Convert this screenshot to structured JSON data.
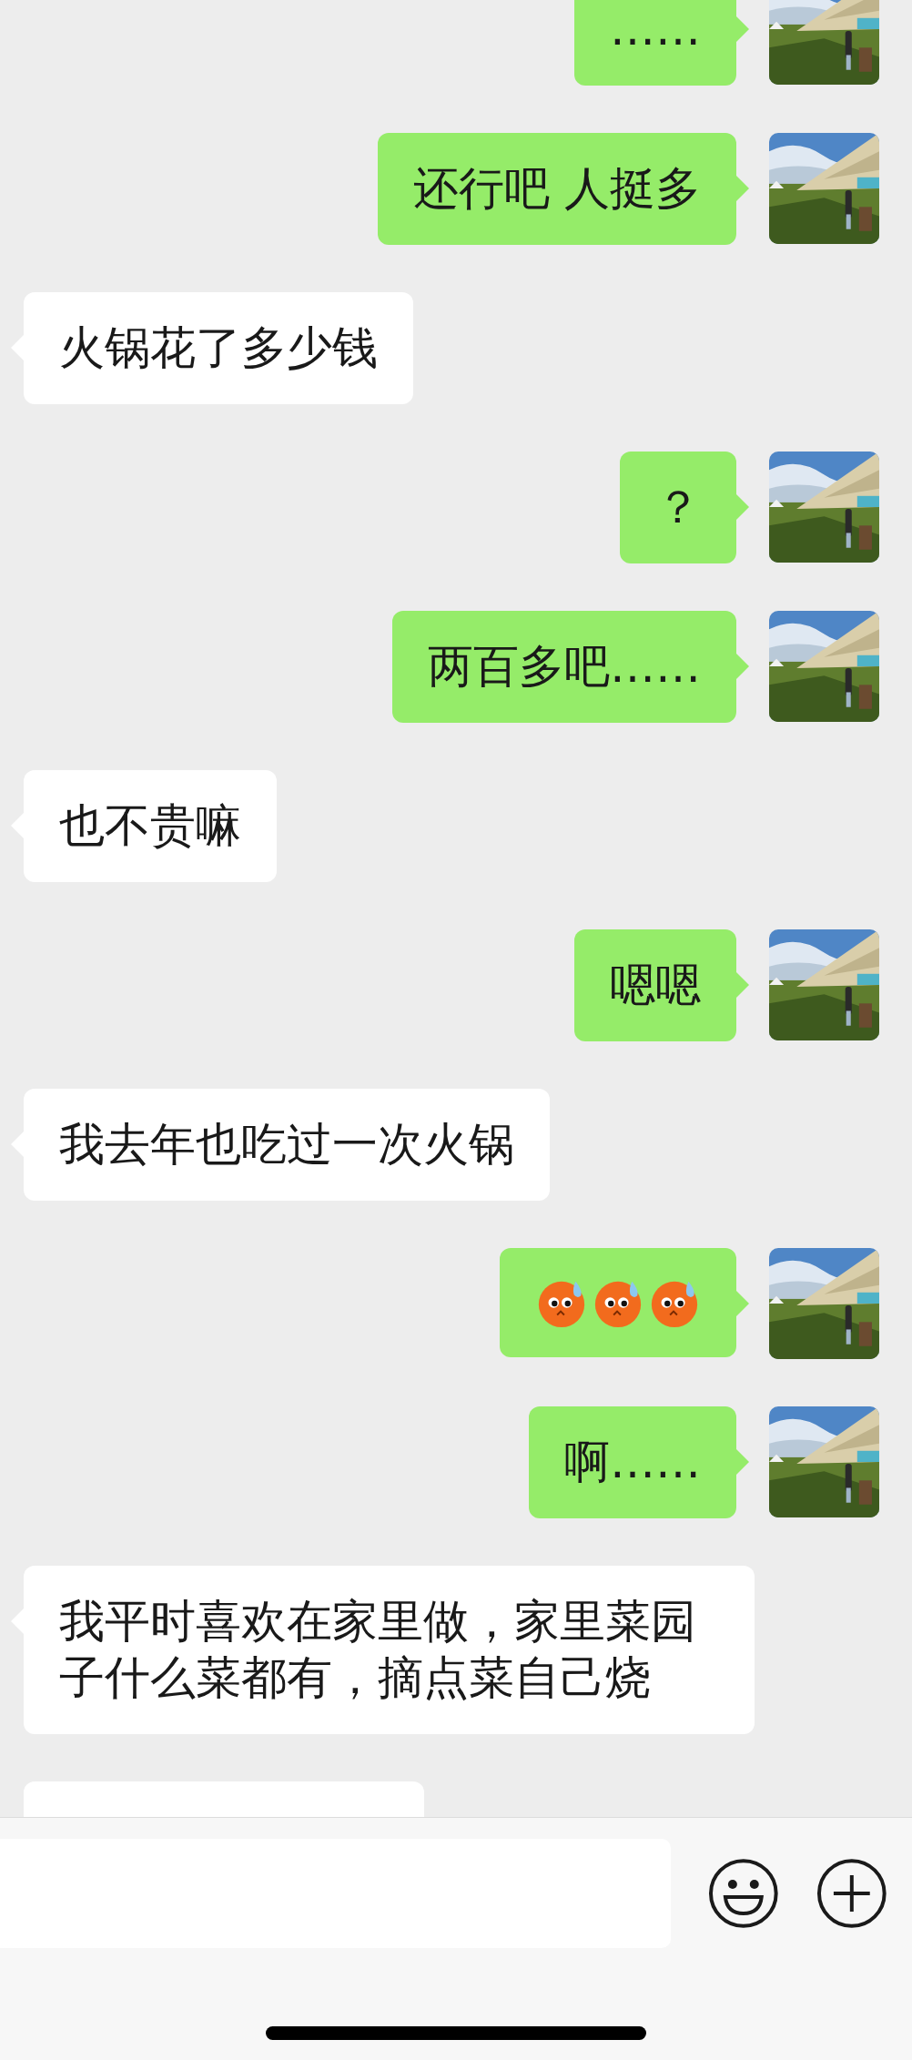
{
  "messages": [
    {
      "outgoing": true,
      "kind": "text",
      "text": "……"
    },
    {
      "outgoing": true,
      "kind": "text",
      "text": "还行吧  人挺多"
    },
    {
      "outgoing": false,
      "kind": "text",
      "text": "火锅花了多少钱"
    },
    {
      "outgoing": true,
      "kind": "text",
      "text": "？"
    },
    {
      "outgoing": true,
      "kind": "text",
      "text": "两百多吧……"
    },
    {
      "outgoing": false,
      "kind": "text",
      "text": "也不贵嘛"
    },
    {
      "outgoing": true,
      "kind": "text",
      "text": "嗯嗯"
    },
    {
      "outgoing": false,
      "kind": "text",
      "text": "我去年也吃过一次火锅"
    },
    {
      "outgoing": true,
      "kind": "emoji",
      "emojis": [
        {
          "kind": "sweat"
        },
        {
          "kind": "sweat"
        },
        {
          "kind": "sweat"
        }
      ]
    },
    {
      "outgoing": true,
      "kind": "text",
      "text": "啊……"
    },
    {
      "outgoing": false,
      "kind": "text",
      "text": "我平时喜欢在家里做，家里菜园子什么菜都有，摘点菜自己烧"
    },
    {
      "outgoing": false,
      "kind": "hidden"
    }
  ],
  "input_bar": {
    "buttons": [
      {
        "kind": "emoji"
      },
      {
        "kind": "plus"
      }
    ]
  }
}
